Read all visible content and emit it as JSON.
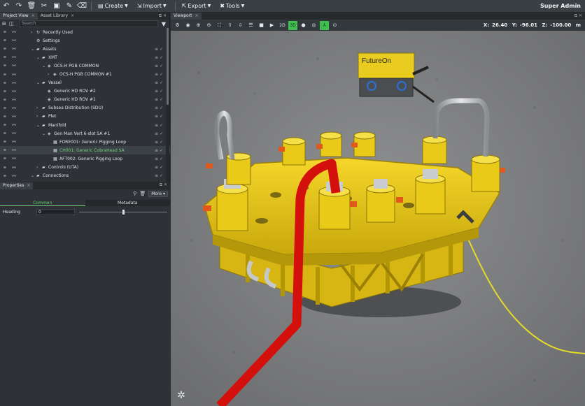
{
  "toolbar": {
    "create_label": "Create",
    "import_label": "Import",
    "export_label": "Export",
    "tools_label": "Tools",
    "user_label": "Super Admin"
  },
  "left_tabs": {
    "project_view": "Project View",
    "asset_library": "Asset Library"
  },
  "search": {
    "placeholder": "Search"
  },
  "tree": [
    {
      "label": "Recently Used",
      "indent": 1,
      "expander": "›",
      "icon": "↻",
      "flags": false
    },
    {
      "label": "Settings",
      "indent": 1,
      "expander": "",
      "icon": "⚙",
      "flags": false
    },
    {
      "label": "Assets",
      "indent": 1,
      "expander": "⌄",
      "icon": "▰",
      "flags": true
    },
    {
      "label": "XMT",
      "indent": 2,
      "expander": "⌄",
      "icon": "▰",
      "flags": true
    },
    {
      "label": "OCS-H PGB COMMON",
      "indent": 3,
      "expander": "⌄",
      "icon": "◈",
      "flags": true
    },
    {
      "label": "OCS-H PGB COMMON #1",
      "indent": 4,
      "expander": "›",
      "icon": "◈",
      "flags": true
    },
    {
      "label": "Vessel",
      "indent": 2,
      "expander": "⌄",
      "icon": "▰",
      "flags": true
    },
    {
      "label": "Generic HD ROV #2",
      "indent": 3,
      "expander": "",
      "icon": "◈",
      "flags": true
    },
    {
      "label": "Generic HD ROV #1",
      "indent": 3,
      "expander": "",
      "icon": "◈",
      "flags": true
    },
    {
      "label": "Subsea Distribution (SDU)",
      "indent": 2,
      "expander": "›",
      "icon": "▰",
      "flags": true
    },
    {
      "label": "Plet",
      "indent": 2,
      "expander": "›",
      "icon": "▰",
      "flags": true
    },
    {
      "label": "Manifold",
      "indent": 2,
      "expander": "⌄",
      "icon": "▰",
      "flags": true
    },
    {
      "label": "Gen Man Vert 6-slot SA #1",
      "indent": 3,
      "expander": "⌄",
      "icon": "◈",
      "flags": true
    },
    {
      "label": "FORE001: Generic Pigging Loop",
      "indent": 4,
      "expander": "",
      "icon": "▦",
      "flags": true
    },
    {
      "label": "CH001: Generic CobraHead SA",
      "indent": 4,
      "expander": "",
      "icon": "▦",
      "flags": true,
      "selected": true
    },
    {
      "label": "AFT002: Generic Pigging Loop",
      "indent": 4,
      "expander": "",
      "icon": "▦",
      "flags": true
    },
    {
      "label": "Controls (UTA)",
      "indent": 2,
      "expander": "›",
      "icon": "▰",
      "flags": true
    },
    {
      "label": "Connections",
      "indent": 1,
      "expander": "⌄",
      "icon": "▰",
      "flags": true
    }
  ],
  "properties": {
    "tab_label": "Properties",
    "more_label": "More",
    "common_tab": "Common",
    "metadata_tab": "Metadata",
    "heading_label": "Heading",
    "heading_value": "0",
    "heading_slider": 0.5
  },
  "viewport": {
    "tab_label": "Viewport",
    "mode_2d": "2D",
    "mode_3d": "3D",
    "x_label": "X:",
    "x_value": "26.40",
    "y_label": "Y:",
    "y_value": "-96.01",
    "z_label": "Z:",
    "z_value": "-100.00",
    "unit": "m"
  },
  "scene": {
    "rov_brand": "FutureOn"
  },
  "colors": {
    "accent_green": "#3fbf4f",
    "selected_text": "#6fd17a",
    "manifold_yellow": "#f2d21a",
    "pipe_red": "#d4100c",
    "cable_yellow": "#e4da2a"
  }
}
